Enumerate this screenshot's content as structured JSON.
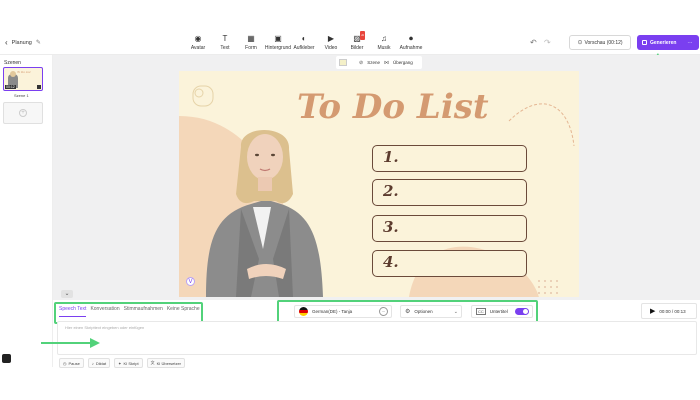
{
  "header": {
    "back_label": "Planung",
    "tools": [
      {
        "label": "Avatar",
        "icon": "avatar-icon"
      },
      {
        "label": "Text",
        "icon": "text-icon"
      },
      {
        "label": "Form",
        "icon": "shapes-icon"
      },
      {
        "label": "Hintergrund",
        "icon": "background-icon"
      },
      {
        "label": "Aufkleber",
        "icon": "sticker-icon"
      },
      {
        "label": "Video",
        "icon": "video-icon"
      },
      {
        "label": "Bilder",
        "icon": "image-icon",
        "badge": "AI"
      },
      {
        "label": "Musik",
        "icon": "music-icon"
      },
      {
        "label": "Aufnahme",
        "icon": "record-icon"
      }
    ],
    "preview_label": "Vorschau (00:12)",
    "generate_label": "Generieren",
    "more_label": "···"
  },
  "scenes": {
    "title": "Szenen",
    "items": [
      {
        "time": "00:12",
        "label": "Szene 1"
      }
    ]
  },
  "canvas_toolbar": {
    "scene_label": "Szene",
    "transition_label": "Übergang"
  },
  "slide": {
    "title": "To Do List",
    "items": [
      "1.",
      "2.",
      "3.",
      "4."
    ]
  },
  "bottom": {
    "tabs": [
      "Speech Text",
      "Konversation",
      "Stimmaufnahmen",
      "Keine Sprache"
    ],
    "active_tab": 0,
    "voice": "German(DE) - Tanja",
    "voice_more": "···",
    "options_label": "Optionen",
    "subtitle_label": "Untertitel",
    "subtitle_on": true,
    "playback_time": "00:00 / 00:13",
    "script_placeholder": "Hier einen Skripttext eingeben oder einfügen",
    "chips": [
      "Pause",
      "Diktat",
      "KI Skript",
      "KI Übersetzer"
    ]
  },
  "colors": {
    "accent": "#7a3ff0",
    "highlight": "#52d27a",
    "slide_bg": "#fbf3da",
    "title_color": "#d49a71"
  }
}
